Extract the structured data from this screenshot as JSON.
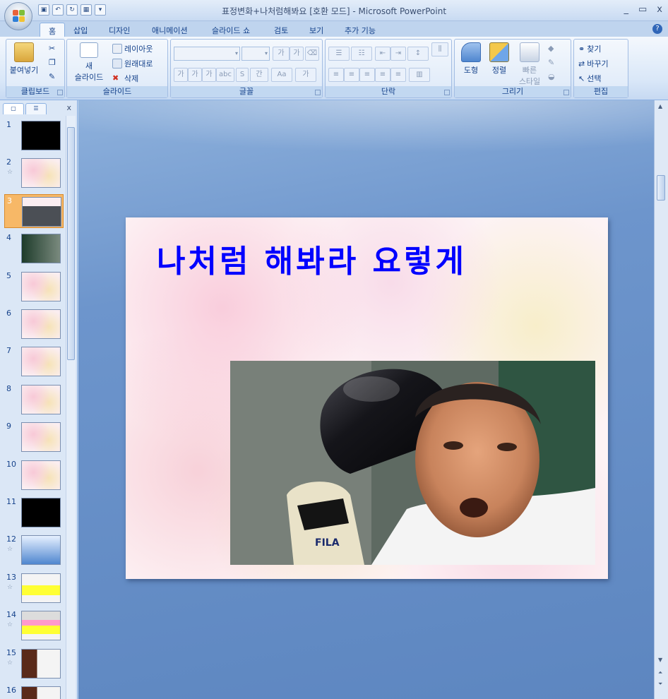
{
  "window": {
    "title": "표정변화+나처럼해봐요 [호환 모드] - Microsoft PowerPoint",
    "controls": [
      "_",
      "▭",
      "x"
    ]
  },
  "ribbon_tabs": [
    "홈",
    "삽입",
    "디자인",
    "애니메이션",
    "슬라이드 쇼",
    "검토",
    "보기",
    "추가 기능"
  ],
  "ribbon": {
    "clipboard": {
      "label": "클립보드",
      "paste": "붙여넣기"
    },
    "slides": {
      "label": "슬라이드",
      "new_slide_line1": "새",
      "new_slide_line2": "슬라이드",
      "layout": "레이아웃",
      "reset": "원래대로",
      "delete": "삭제"
    },
    "font": {
      "label": "글꼴",
      "increase": "가",
      "decrease": "가",
      "bold": "가",
      "italic": "가",
      "underline": "가",
      "strike": "abc",
      "shadow": "S",
      "spacing": "간",
      "case": "Aa",
      "color": "가"
    },
    "paragraph": {
      "label": "단락"
    },
    "drawing": {
      "label": "그리기",
      "shapes": "도형",
      "arrange": "정렬",
      "quick_styles_line1": "빠른",
      "quick_styles_line2": "스타일"
    },
    "editing": {
      "label": "편집",
      "find": "찾기",
      "replace": "바꾸기",
      "select": "선택"
    }
  },
  "slides_panel": {
    "close": "x",
    "slides": [
      {
        "num": "1",
        "kind": "black",
        "animated": false
      },
      {
        "num": "2",
        "kind": "pastel",
        "animated": true
      },
      {
        "num": "3",
        "kind": "photo",
        "animated": false,
        "selected": true
      },
      {
        "num": "4",
        "kind": "photo-dark",
        "animated": false
      },
      {
        "num": "5",
        "kind": "pastel-photo",
        "animated": false
      },
      {
        "num": "6",
        "kind": "pastel-text",
        "animated": false
      },
      {
        "num": "7",
        "kind": "pastel-photo",
        "animated": false
      },
      {
        "num": "8",
        "kind": "pastel-photo",
        "animated": false
      },
      {
        "num": "9",
        "kind": "pastel-photo",
        "animated": false
      },
      {
        "num": "10",
        "kind": "pastel-text",
        "animated": false
      },
      {
        "num": "11",
        "kind": "black",
        "animated": false
      },
      {
        "num": "12",
        "kind": "blue",
        "animated": true
      },
      {
        "num": "13",
        "kind": "yellow",
        "animated": true
      },
      {
        "num": "14",
        "kind": "pink-yellow",
        "animated": true
      },
      {
        "num": "15",
        "kind": "anime",
        "animated": true
      },
      {
        "num": "16",
        "kind": "anime",
        "animated": false
      }
    ]
  },
  "current_slide": {
    "title": "나처럼 해봐라 요렇게",
    "title_color": "#0000ff"
  }
}
